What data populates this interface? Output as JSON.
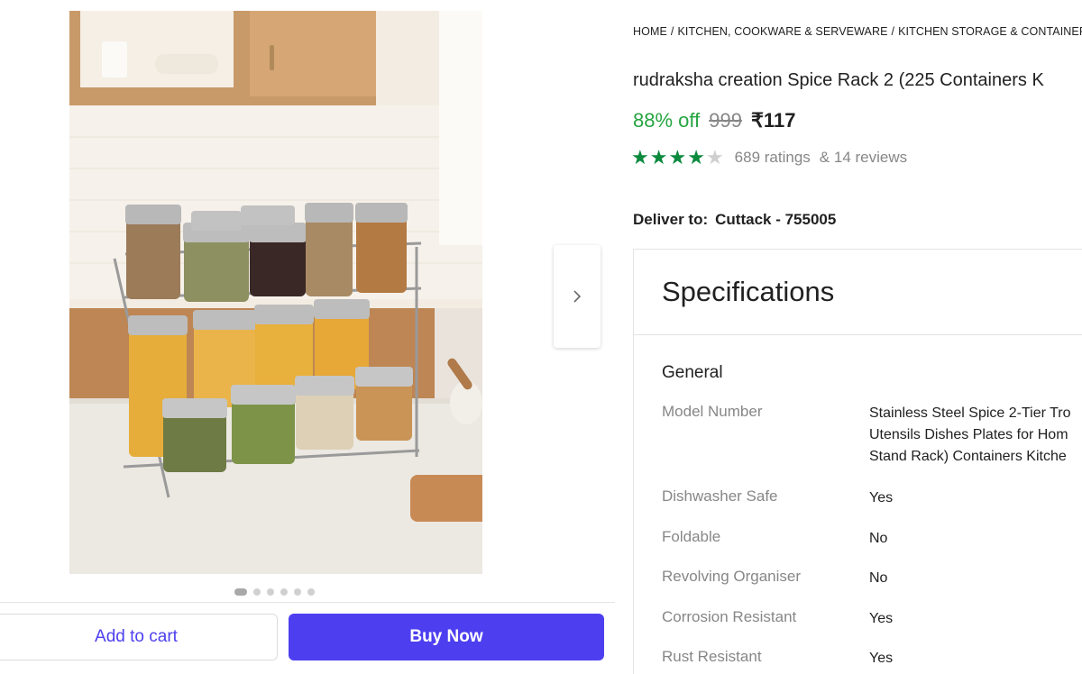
{
  "breadcrumb": [
    "HOME",
    "KITCHEN, COOKWARE & SERVEWARE",
    "KITCHEN STORAGE & CONTAINER"
  ],
  "breadcrumb_separator": "/",
  "product": {
    "title": "rudraksha creation Spice Rack 2 (225 Containers K",
    "discount": "88% off",
    "mrp": "999",
    "price": "₹117",
    "rating_stars": 4,
    "rating_max": 5,
    "ratings_label": "689 ratings",
    "reviews_label": "& 14 reviews"
  },
  "delivery": {
    "label": "Deliver to:",
    "location": "Cuttack - 755005"
  },
  "carousel": {
    "image_count": 6,
    "active_index": 0,
    "next_icon": "chevron-right-icon"
  },
  "actions": {
    "add_to_cart": "Add to cart",
    "buy_now": "Buy Now"
  },
  "specifications": {
    "title": "Specifications",
    "group": "General",
    "rows": [
      {
        "key": "Model Number",
        "value": [
          "Stainless Steel Spice 2-Tier Tro",
          "Utensils Dishes Plates for Hom",
          "Stand Rack) Containers Kitche"
        ]
      },
      {
        "key": "Dishwasher Safe",
        "value": [
          "Yes"
        ]
      },
      {
        "key": "Foldable",
        "value": [
          "No"
        ]
      },
      {
        "key": "Revolving Organiser",
        "value": [
          "No"
        ]
      },
      {
        "key": "Corrosion Resistant",
        "value": [
          "Yes"
        ]
      },
      {
        "key": "Rust Resistant",
        "value": [
          "Yes"
        ]
      }
    ]
  },
  "colors": {
    "accent": "#4d3ff0",
    "discount_green": "#26a541",
    "star_green": "#0b8a3e",
    "muted_text": "#878787"
  }
}
